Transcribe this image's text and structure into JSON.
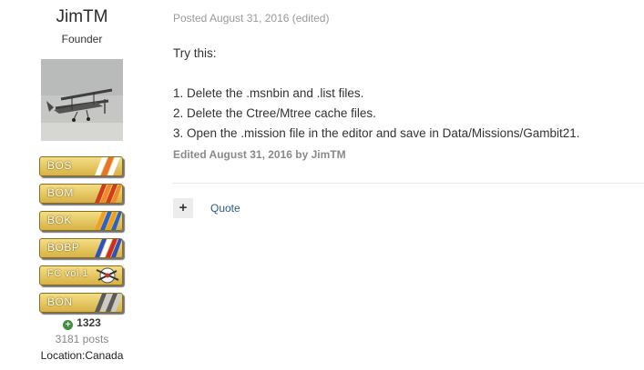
{
  "author": {
    "name": "JimTM",
    "role": "Founder",
    "badges": [
      {
        "label": "BOS",
        "icon": "stripes-white-orange"
      },
      {
        "label": "BOM",
        "icon": "stripes-red-orange"
      },
      {
        "label": "BOK",
        "icon": "stripes-orange-blue"
      },
      {
        "label": "BOBP",
        "icon": "stripes-blue-red"
      },
      {
        "label": "FC vol.1",
        "icon": "biplane"
      },
      {
        "label": "BON",
        "icon": "stripes-gray"
      }
    ],
    "reputation": "1323",
    "posts": "3181 posts",
    "location": "Location:Canada"
  },
  "post": {
    "posted": "Posted August 31, 2016 (edited)",
    "lines": [
      "Try this:",
      "1. Delete the .msnbin and .list files.",
      "2. Delete the Ctree/Mtree cache files.",
      "3. Open the .mission file in the editor and save in Data/Missions/Gambit21."
    ],
    "edited": "Edited August 31, 2016 by JimTM"
  },
  "actions": {
    "plus": "+",
    "quote": "Quote"
  }
}
